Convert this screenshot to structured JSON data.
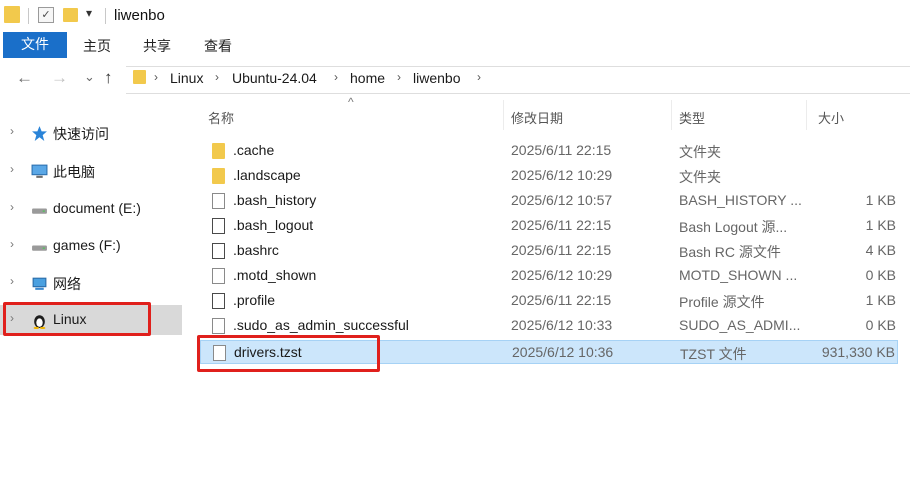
{
  "window": {
    "title": "liwenbo",
    "quick_access_arrow": "▾"
  },
  "ribbon": {
    "tabs": [
      "文件",
      "主页",
      "共享",
      "查看"
    ]
  },
  "nav": {
    "back": "←",
    "forward": "→",
    "recent": "⌄",
    "up": "↑"
  },
  "address": {
    "crumbs": [
      "Linux",
      "Ubuntu-24.04",
      "home",
      "liwenbo"
    ],
    "separator": "›"
  },
  "sidebar": {
    "items": [
      {
        "label": "快速访问",
        "icon": "star-icon"
      },
      {
        "label": "此电脑",
        "icon": "computer-icon"
      },
      {
        "label": "document (E:)",
        "icon": "drive-icon"
      },
      {
        "label": "games (F:)",
        "icon": "drive-icon"
      },
      {
        "label": "网络",
        "icon": "network-icon"
      },
      {
        "label": "Linux",
        "icon": "tux-icon"
      }
    ],
    "chevron": "›"
  },
  "columns": {
    "name": "名称",
    "date": "修改日期",
    "type": "类型",
    "size": "大小",
    "sort_caret": "^"
  },
  "files": [
    {
      "name": ".cache",
      "date": "2025/6/11 22:15",
      "type": "文件夹",
      "size": "",
      "icon": "folder-icon"
    },
    {
      "name": ".landscape",
      "date": "2025/6/12 10:29",
      "type": "文件夹",
      "size": "",
      "icon": "folder-icon"
    },
    {
      "name": ".bash_history",
      "date": "2025/6/12 10:57",
      "type": "BASH_HISTORY ...",
      "size": "1 KB",
      "icon": "file-icon"
    },
    {
      "name": ".bash_logout",
      "date": "2025/6/11 22:15",
      "type": "Bash Logout 源...",
      "size": "1 KB",
      "icon": "script-file-icon"
    },
    {
      "name": ".bashrc",
      "date": "2025/6/11 22:15",
      "type": "Bash RC 源文件",
      "size": "4 KB",
      "icon": "script-file-icon"
    },
    {
      "name": ".motd_shown",
      "date": "2025/6/12 10:29",
      "type": "MOTD_SHOWN ...",
      "size": "0 KB",
      "icon": "file-icon"
    },
    {
      "name": ".profile",
      "date": "2025/6/11 22:15",
      "type": "Profile 源文件",
      "size": "1 KB",
      "icon": "script-file-icon"
    },
    {
      "name": ".sudo_as_admin_successful",
      "date": "2025/6/12 10:33",
      "type": "SUDO_AS_ADMI...",
      "size": "0 KB",
      "icon": "file-icon"
    },
    {
      "name": "drivers.tzst",
      "date": "2025/6/12 10:36",
      "type": "TZST 文件",
      "size": "931,330 KB",
      "icon": "file-icon"
    }
  ],
  "colors": {
    "accent": "#1a6fc9",
    "selection": "#cce6fb",
    "highlight_box": "#e0201c"
  }
}
